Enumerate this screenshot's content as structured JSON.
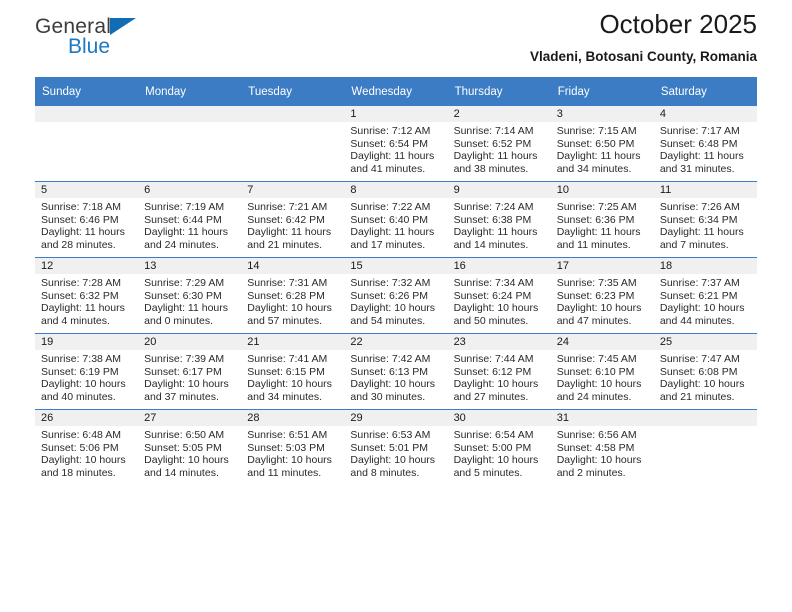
{
  "brand": {
    "name_top": "General",
    "name_bottom": "Blue",
    "accent_color": "#1b7ac4",
    "triangle_color": "#0f6cb5"
  },
  "header": {
    "title": "October 2025",
    "subtitle": "Vladeni, Botosani County, Romania"
  },
  "calendar": {
    "header_bg": "#3b7cc4",
    "daynum_bg": "#f0f0f0",
    "weekdays": [
      "Sunday",
      "Monday",
      "Tuesday",
      "Wednesday",
      "Thursday",
      "Friday",
      "Saturday"
    ],
    "weeks": [
      [
        {
          "day": "",
          "empty": true
        },
        {
          "day": "",
          "empty": true
        },
        {
          "day": "",
          "empty": true
        },
        {
          "day": "1",
          "sunrise": "Sunrise: 7:12 AM",
          "sunset": "Sunset: 6:54 PM",
          "daylight_1": "Daylight: 11 hours",
          "daylight_2": "and 41 minutes."
        },
        {
          "day": "2",
          "sunrise": "Sunrise: 7:14 AM",
          "sunset": "Sunset: 6:52 PM",
          "daylight_1": "Daylight: 11 hours",
          "daylight_2": "and 38 minutes."
        },
        {
          "day": "3",
          "sunrise": "Sunrise: 7:15 AM",
          "sunset": "Sunset: 6:50 PM",
          "daylight_1": "Daylight: 11 hours",
          "daylight_2": "and 34 minutes."
        },
        {
          "day": "4",
          "sunrise": "Sunrise: 7:17 AM",
          "sunset": "Sunset: 6:48 PM",
          "daylight_1": "Daylight: 11 hours",
          "daylight_2": "and 31 minutes."
        }
      ],
      [
        {
          "day": "5",
          "sunrise": "Sunrise: 7:18 AM",
          "sunset": "Sunset: 6:46 PM",
          "daylight_1": "Daylight: 11 hours",
          "daylight_2": "and 28 minutes."
        },
        {
          "day": "6",
          "sunrise": "Sunrise: 7:19 AM",
          "sunset": "Sunset: 6:44 PM",
          "daylight_1": "Daylight: 11 hours",
          "daylight_2": "and 24 minutes."
        },
        {
          "day": "7",
          "sunrise": "Sunrise: 7:21 AM",
          "sunset": "Sunset: 6:42 PM",
          "daylight_1": "Daylight: 11 hours",
          "daylight_2": "and 21 minutes."
        },
        {
          "day": "8",
          "sunrise": "Sunrise: 7:22 AM",
          "sunset": "Sunset: 6:40 PM",
          "daylight_1": "Daylight: 11 hours",
          "daylight_2": "and 17 minutes."
        },
        {
          "day": "9",
          "sunrise": "Sunrise: 7:24 AM",
          "sunset": "Sunset: 6:38 PM",
          "daylight_1": "Daylight: 11 hours",
          "daylight_2": "and 14 minutes."
        },
        {
          "day": "10",
          "sunrise": "Sunrise: 7:25 AM",
          "sunset": "Sunset: 6:36 PM",
          "daylight_1": "Daylight: 11 hours",
          "daylight_2": "and 11 minutes."
        },
        {
          "day": "11",
          "sunrise": "Sunrise: 7:26 AM",
          "sunset": "Sunset: 6:34 PM",
          "daylight_1": "Daylight: 11 hours",
          "daylight_2": "and 7 minutes."
        }
      ],
      [
        {
          "day": "12",
          "sunrise": "Sunrise: 7:28 AM",
          "sunset": "Sunset: 6:32 PM",
          "daylight_1": "Daylight: 11 hours",
          "daylight_2": "and 4 minutes."
        },
        {
          "day": "13",
          "sunrise": "Sunrise: 7:29 AM",
          "sunset": "Sunset: 6:30 PM",
          "daylight_1": "Daylight: 11 hours",
          "daylight_2": "and 0 minutes."
        },
        {
          "day": "14",
          "sunrise": "Sunrise: 7:31 AM",
          "sunset": "Sunset: 6:28 PM",
          "daylight_1": "Daylight: 10 hours",
          "daylight_2": "and 57 minutes."
        },
        {
          "day": "15",
          "sunrise": "Sunrise: 7:32 AM",
          "sunset": "Sunset: 6:26 PM",
          "daylight_1": "Daylight: 10 hours",
          "daylight_2": "and 54 minutes."
        },
        {
          "day": "16",
          "sunrise": "Sunrise: 7:34 AM",
          "sunset": "Sunset: 6:24 PM",
          "daylight_1": "Daylight: 10 hours",
          "daylight_2": "and 50 minutes."
        },
        {
          "day": "17",
          "sunrise": "Sunrise: 7:35 AM",
          "sunset": "Sunset: 6:23 PM",
          "daylight_1": "Daylight: 10 hours",
          "daylight_2": "and 47 minutes."
        },
        {
          "day": "18",
          "sunrise": "Sunrise: 7:37 AM",
          "sunset": "Sunset: 6:21 PM",
          "daylight_1": "Daylight: 10 hours",
          "daylight_2": "and 44 minutes."
        }
      ],
      [
        {
          "day": "19",
          "sunrise": "Sunrise: 7:38 AM",
          "sunset": "Sunset: 6:19 PM",
          "daylight_1": "Daylight: 10 hours",
          "daylight_2": "and 40 minutes."
        },
        {
          "day": "20",
          "sunrise": "Sunrise: 7:39 AM",
          "sunset": "Sunset: 6:17 PM",
          "daylight_1": "Daylight: 10 hours",
          "daylight_2": "and 37 minutes."
        },
        {
          "day": "21",
          "sunrise": "Sunrise: 7:41 AM",
          "sunset": "Sunset: 6:15 PM",
          "daylight_1": "Daylight: 10 hours",
          "daylight_2": "and 34 minutes."
        },
        {
          "day": "22",
          "sunrise": "Sunrise: 7:42 AM",
          "sunset": "Sunset: 6:13 PM",
          "daylight_1": "Daylight: 10 hours",
          "daylight_2": "and 30 minutes."
        },
        {
          "day": "23",
          "sunrise": "Sunrise: 7:44 AM",
          "sunset": "Sunset: 6:12 PM",
          "daylight_1": "Daylight: 10 hours",
          "daylight_2": "and 27 minutes."
        },
        {
          "day": "24",
          "sunrise": "Sunrise: 7:45 AM",
          "sunset": "Sunset: 6:10 PM",
          "daylight_1": "Daylight: 10 hours",
          "daylight_2": "and 24 minutes."
        },
        {
          "day": "25",
          "sunrise": "Sunrise: 7:47 AM",
          "sunset": "Sunset: 6:08 PM",
          "daylight_1": "Daylight: 10 hours",
          "daylight_2": "and 21 minutes."
        }
      ],
      [
        {
          "day": "26",
          "sunrise": "Sunrise: 6:48 AM",
          "sunset": "Sunset: 5:06 PM",
          "daylight_1": "Daylight: 10 hours",
          "daylight_2": "and 18 minutes."
        },
        {
          "day": "27",
          "sunrise": "Sunrise: 6:50 AM",
          "sunset": "Sunset: 5:05 PM",
          "daylight_1": "Daylight: 10 hours",
          "daylight_2": "and 14 minutes."
        },
        {
          "day": "28",
          "sunrise": "Sunrise: 6:51 AM",
          "sunset": "Sunset: 5:03 PM",
          "daylight_1": "Daylight: 10 hours",
          "daylight_2": "and 11 minutes."
        },
        {
          "day": "29",
          "sunrise": "Sunrise: 6:53 AM",
          "sunset": "Sunset: 5:01 PM",
          "daylight_1": "Daylight: 10 hours",
          "daylight_2": "and 8 minutes."
        },
        {
          "day": "30",
          "sunrise": "Sunrise: 6:54 AM",
          "sunset": "Sunset: 5:00 PM",
          "daylight_1": "Daylight: 10 hours",
          "daylight_2": "and 5 minutes."
        },
        {
          "day": "31",
          "sunrise": "Sunrise: 6:56 AM",
          "sunset": "Sunset: 4:58 PM",
          "daylight_1": "Daylight: 10 hours",
          "daylight_2": "and 2 minutes."
        },
        {
          "day": "",
          "empty": true
        }
      ]
    ]
  }
}
